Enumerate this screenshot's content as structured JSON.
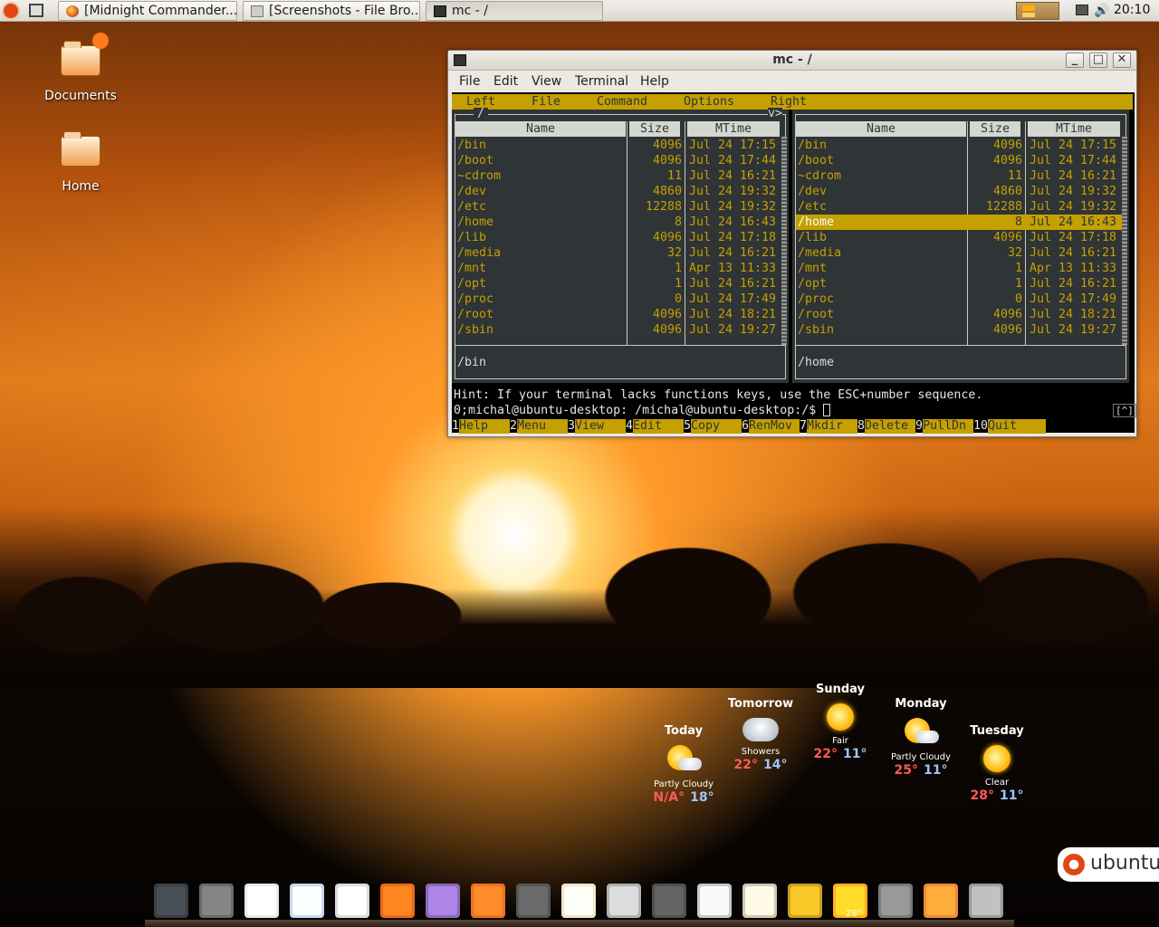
{
  "top_panel": {
    "tasks": [
      {
        "label": "[Midnight Commander..."
      },
      {
        "label": "[Screenshots - File Bro..."
      },
      {
        "label": "mc - /"
      }
    ],
    "clock": "20:10"
  },
  "desktop": {
    "icons": [
      {
        "label": "Documents"
      },
      {
        "label": "Home"
      }
    ]
  },
  "window": {
    "title": "mc - /",
    "menubar": [
      "File",
      "Edit",
      "View",
      "Terminal",
      "Help"
    ],
    "controls": {
      "minimize": "_",
      "maximize": "□",
      "close": "✕"
    }
  },
  "mc": {
    "menu": [
      "Left",
      "File",
      "Command",
      "Options",
      "Right"
    ],
    "columns": {
      "name": "Name",
      "size": "Size",
      "mtime": "MTime"
    },
    "left_panel": {
      "path": "/",
      "path_right": "v>",
      "status": "/bin",
      "rows": [
        {
          "name": "/bin",
          "size": "4096",
          "mtime": "Jul 24 17:15"
        },
        {
          "name": "/boot",
          "size": "4096",
          "mtime": "Jul 24 17:44"
        },
        {
          "name": "~cdrom",
          "size": "11",
          "mtime": "Jul 24 16:21"
        },
        {
          "name": "/dev",
          "size": "4860",
          "mtime": "Jul 24 19:32"
        },
        {
          "name": "/etc",
          "size": "12288",
          "mtime": "Jul 24 19:32"
        },
        {
          "name": "/home",
          "size": "8",
          "mtime": "Jul 24 16:43"
        },
        {
          "name": "/lib",
          "size": "4096",
          "mtime": "Jul 24 17:18"
        },
        {
          "name": "/media",
          "size": "32",
          "mtime": "Jul 24 16:21"
        },
        {
          "name": "/mnt",
          "size": "1",
          "mtime": "Apr 13 11:33"
        },
        {
          "name": "/opt",
          "size": "1",
          "mtime": "Jul 24 16:21"
        },
        {
          "name": "/proc",
          "size": "0",
          "mtime": "Jul 24 17:49"
        },
        {
          "name": "/root",
          "size": "4096",
          "mtime": "Jul 24 18:21"
        },
        {
          "name": "/sbin",
          "size": "4096",
          "mtime": "Jul 24 19:27"
        }
      ]
    },
    "right_panel": {
      "path": "",
      "status": "/home",
      "selected_index": 5,
      "rows": [
        {
          "name": "/bin",
          "size": "4096",
          "mtime": "Jul 24 17:15"
        },
        {
          "name": "/boot",
          "size": "4096",
          "mtime": "Jul 24 17:44"
        },
        {
          "name": "~cdrom",
          "size": "11",
          "mtime": "Jul 24 16:21"
        },
        {
          "name": "/dev",
          "size": "4860",
          "mtime": "Jul 24 19:32"
        },
        {
          "name": "/etc",
          "size": "12288",
          "mtime": "Jul 24 19:32"
        },
        {
          "name": "/home",
          "size": "8",
          "mtime": "Jul 24 16:43"
        },
        {
          "name": "/lib",
          "size": "4096",
          "mtime": "Jul 24 17:18"
        },
        {
          "name": "/media",
          "size": "32",
          "mtime": "Jul 24 16:21"
        },
        {
          "name": "/mnt",
          "size": "1",
          "mtime": "Apr 13 11:33"
        },
        {
          "name": "/opt",
          "size": "1",
          "mtime": "Jul 24 16:21"
        },
        {
          "name": "/proc",
          "size": "0",
          "mtime": "Jul 24 17:49"
        },
        {
          "name": "/root",
          "size": "4096",
          "mtime": "Jul 24 18:21"
        },
        {
          "name": "/sbin",
          "size": "4096",
          "mtime": "Jul 24 19:27"
        }
      ]
    },
    "hint": "Hint: If your terminal lacks functions keys, use the ESC+number sequence.",
    "prompt": "0;michal@ubuntu-desktop: /michal@ubuntu-desktop:/$ ",
    "ctrl_o": "[^]",
    "fkeys": [
      {
        "num": "1",
        "label": "Help"
      },
      {
        "num": "2",
        "label": "Menu"
      },
      {
        "num": "3",
        "label": "View"
      },
      {
        "num": "4",
        "label": "Edit"
      },
      {
        "num": "5",
        "label": "Copy"
      },
      {
        "num": "6",
        "label": "RenMov"
      },
      {
        "num": "7",
        "label": "Mkdir"
      },
      {
        "num": "8",
        "label": "Delete"
      },
      {
        "num": "9",
        "label": "PullDn"
      },
      {
        "num": "10",
        "label": "Quit"
      }
    ]
  },
  "weather": {
    "days": [
      {
        "day": "Today",
        "condition": "Partly Cloudy",
        "high": "N/A°",
        "low": "18°",
        "icon": "partly-cloudy-icon"
      },
      {
        "day": "Tomorrow",
        "condition": "Showers",
        "high": "22°",
        "low": "14°",
        "icon": "showers-icon"
      },
      {
        "day": "Sunday",
        "condition": "Fair",
        "high": "22°",
        "low": "11°",
        "icon": "sun-icon"
      },
      {
        "day": "Monday",
        "condition": "Partly Cloudy",
        "high": "25°",
        "low": "11°",
        "icon": "partly-cloudy-icon"
      },
      {
        "day": "Tuesday",
        "condition": "Clear",
        "high": "28°",
        "low": "11°",
        "icon": "sun-icon"
      }
    ]
  },
  "ubuntu_logo": "ubuntu",
  "dock": {
    "weather_caption": "28°",
    "icons": [
      "terminal-icon",
      "gimp-icon",
      "text-editor-icon",
      "office-icon",
      "mail-icon",
      "firefox-icon",
      "pidgin-icon",
      "flame-icon",
      "inkscape-icon",
      "notes-icon",
      "calculator-icon",
      "camera-icon",
      "scanner-icon",
      "goat-icon",
      "clock-icon",
      "weather-icon",
      "volume-icon",
      "trash-icon",
      "downloads-icon"
    ]
  },
  "colors": {
    "mc_yellow": "#c4a000",
    "mc_panel_bg": "#2f3436",
    "mc_header_bg": "#d3d7cf",
    "weather_high": "#ff5a5a",
    "weather_low": "#9dc3ff"
  }
}
